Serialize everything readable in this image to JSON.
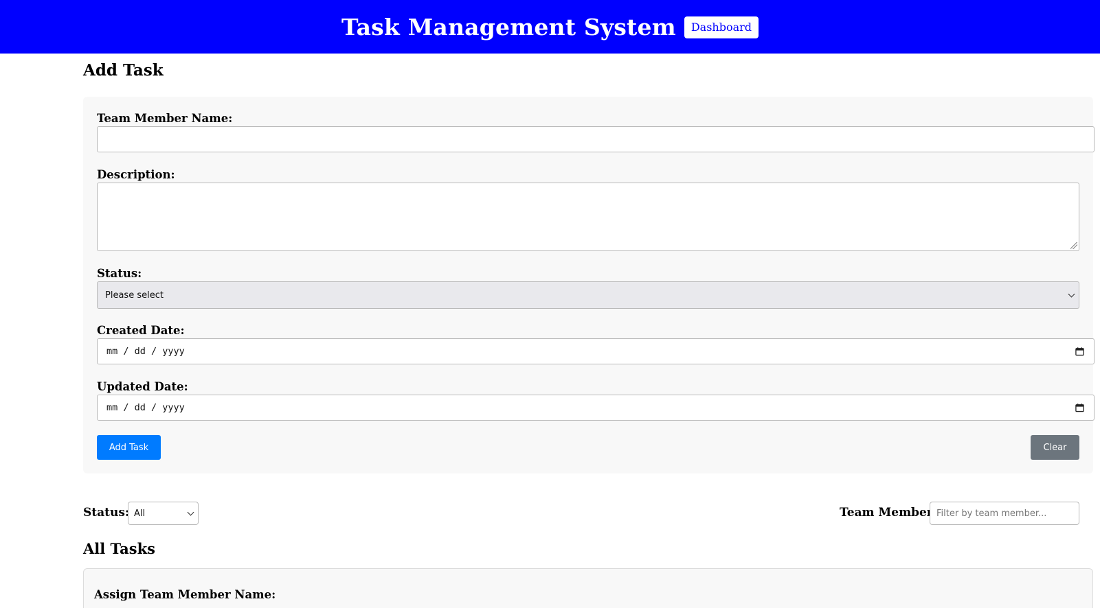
{
  "header": {
    "title": "Task Management System",
    "dashboard_label": "Dashboard",
    "bg_color": "#0000ff"
  },
  "form": {
    "heading": "Add Task",
    "team_member_label": "Team Member Name:",
    "team_member_value": "",
    "description_label": "Description:",
    "description_value": "",
    "status_label": "Status:",
    "status_selected": "Please select",
    "created_date_label": "Created Date:",
    "created_date_placeholder": "mm / dd / yyyy",
    "updated_date_label": "Updated Date:",
    "updated_date_placeholder": "mm / dd / yyyy",
    "add_button_label": "Add Task",
    "clear_button_label": "Clear"
  },
  "filters": {
    "status_label": "Status:",
    "status_selected": "All",
    "team_member_label": "Team Member:",
    "team_member_placeholder": "Filter by team member..."
  },
  "tasks": {
    "heading": "All Tasks",
    "card_first_label": "Assign Team Member Name:"
  },
  "colors": {
    "primary_button": "#007bff",
    "secondary_button": "#6c757d"
  },
  "icons": [
    "calendar-icon",
    "chevron-down-icon"
  ]
}
